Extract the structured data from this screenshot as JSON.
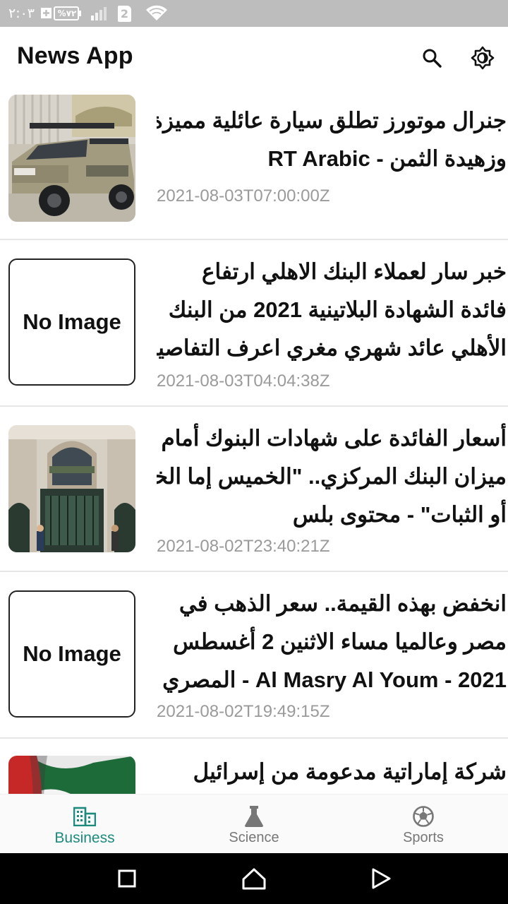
{
  "status_bar": {
    "time": "٢:٠٣",
    "battery": "%٧٢",
    "sim": "2",
    "icons": [
      "battery-charging-icon",
      "signal-icon",
      "sim-icon",
      "wifi-icon"
    ]
  },
  "app_bar": {
    "title": "News App",
    "icons": [
      "search-icon",
      "brightness-icon"
    ]
  },
  "articles": [
    {
      "image": "car-photo",
      "title_lines": [
        "جنرال موتورز تطلق سيارة عائلية مميزة",
        "وزهيدة الثمن - RT Arabic"
      ],
      "date": "2021-08-03T07:00:00Z"
    },
    {
      "image": null,
      "no_image_label": "No Image",
      "title_lines": [
        "خبر سار لعملاء البنك الاهلي ارتفاع",
        "فائدة الشهادة البلاتينية 2021 من البنك",
        "الأهلي عائد شهري مغري اعرف التفاصيل الآن"
      ],
      "date": "2021-08-03T04:04:38Z"
    },
    {
      "image": "bank-building-photo",
      "title_lines": [
        "أسعار الفائدة على شهادات البنوك أمام",
        "ميزان البنك المركزي.. \"الخميس إما الخفض",
        "أو الثبات\" - محتوى بلس"
      ],
      "date": "2021-08-02T23:40:21Z"
    },
    {
      "image": null,
      "no_image_label": "No Image",
      "title_lines": [
        "انخفض بهذه القيمة.. سعر الذهب في",
        "مصر وعالميا مساء الاثنين 2 أغسطس",
        "2021 - Al Masry Al Youm - المصري"
      ],
      "date": "2021-08-02T19:49:15Z"
    },
    {
      "image": "uae-flag-photo",
      "title_lines": [
        "شركة إماراتية مدعومة من إسرائيل"
      ],
      "date": ""
    }
  ],
  "bottom_nav": {
    "items": [
      {
        "label": "Business",
        "icon": "business-icon",
        "active": true
      },
      {
        "label": "Science",
        "icon": "flask-icon",
        "active": false
      },
      {
        "label": "Sports",
        "icon": "soccer-ball-icon",
        "active": false
      }
    ],
    "active_color": "#1e8a7e",
    "inactive_color": "#777777"
  },
  "system_nav": {
    "icons": [
      "recents-icon",
      "home-icon",
      "back-icon"
    ]
  }
}
